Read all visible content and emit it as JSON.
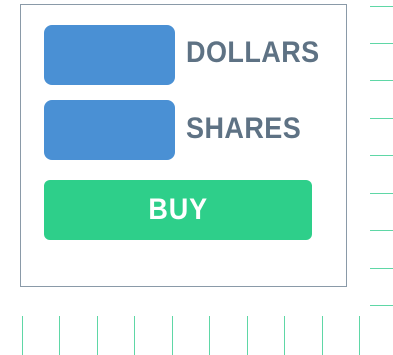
{
  "form": {
    "dollars_label": "DOLLARS",
    "shares_label": "SHARES",
    "buy_label": "BUY"
  },
  "colors": {
    "input_fill": "#4a90d4",
    "buy_fill": "#2ecf8a",
    "label_text": "#5e7284",
    "tick_marks": "#5fd7a6"
  }
}
